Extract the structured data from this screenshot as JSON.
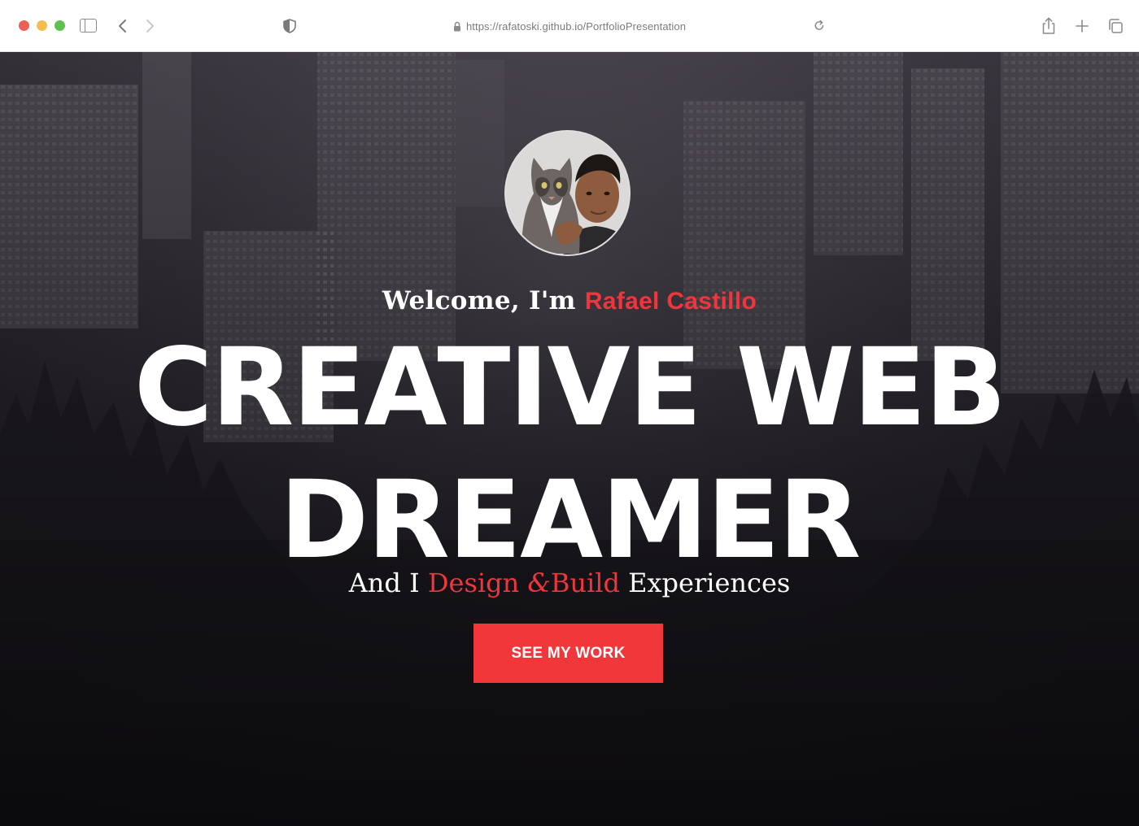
{
  "browser": {
    "url": "https://rafatoski.github.io/PortfolioPresentation",
    "icons": [
      "sidebar-icon",
      "chevron-left-icon",
      "chevron-right-icon",
      "shield-icon",
      "lock-icon",
      "reload-icon",
      "share-icon",
      "plus-icon",
      "tabs-icon"
    ]
  },
  "hero": {
    "welcome_prefix": "Welcome, I'm",
    "name": "Rafael Castillo",
    "headline_line1": "CREATIVE WEB",
    "headline_line2": "DREAMER",
    "tagline": {
      "and_i": "And I",
      "design": "Design",
      "amp": "&",
      "build": "Build",
      "experiences": "Experiences"
    },
    "cta_label": "SEE MY WORK"
  },
  "colors": {
    "accent": "#f0363c",
    "cta_bg": "#f2373b",
    "text": "#ffffff"
  }
}
